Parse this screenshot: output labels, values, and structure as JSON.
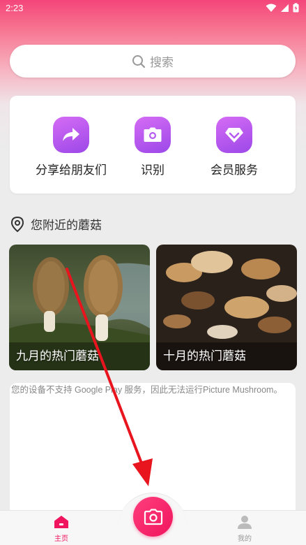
{
  "status_bar": {
    "time": "2:23"
  },
  "search": {
    "placeholder": "搜索"
  },
  "quick_actions": [
    {
      "label": "分享给朋友们",
      "icon": "share-arrow-icon"
    },
    {
      "label": "识别",
      "icon": "camera-icon"
    },
    {
      "label": "会员服务",
      "icon": "diamond-icon"
    }
  ],
  "nearby": {
    "title": "您附近的蘑菇",
    "tiles": [
      {
        "label": "九月的热门蘑菇"
      },
      {
        "label": "十月的热门蘑菇"
      }
    ]
  },
  "notice": {
    "text": "您的设备不支持 Google Play 服务，因此无法运行Picture Mushroom。"
  },
  "bottom_nav": {
    "home": "主页",
    "mine": "我的",
    "active_color": "#f0155e",
    "inactive_color": "#999999"
  },
  "colors": {
    "accent": "#f0155e",
    "purple": "#a94fee"
  }
}
